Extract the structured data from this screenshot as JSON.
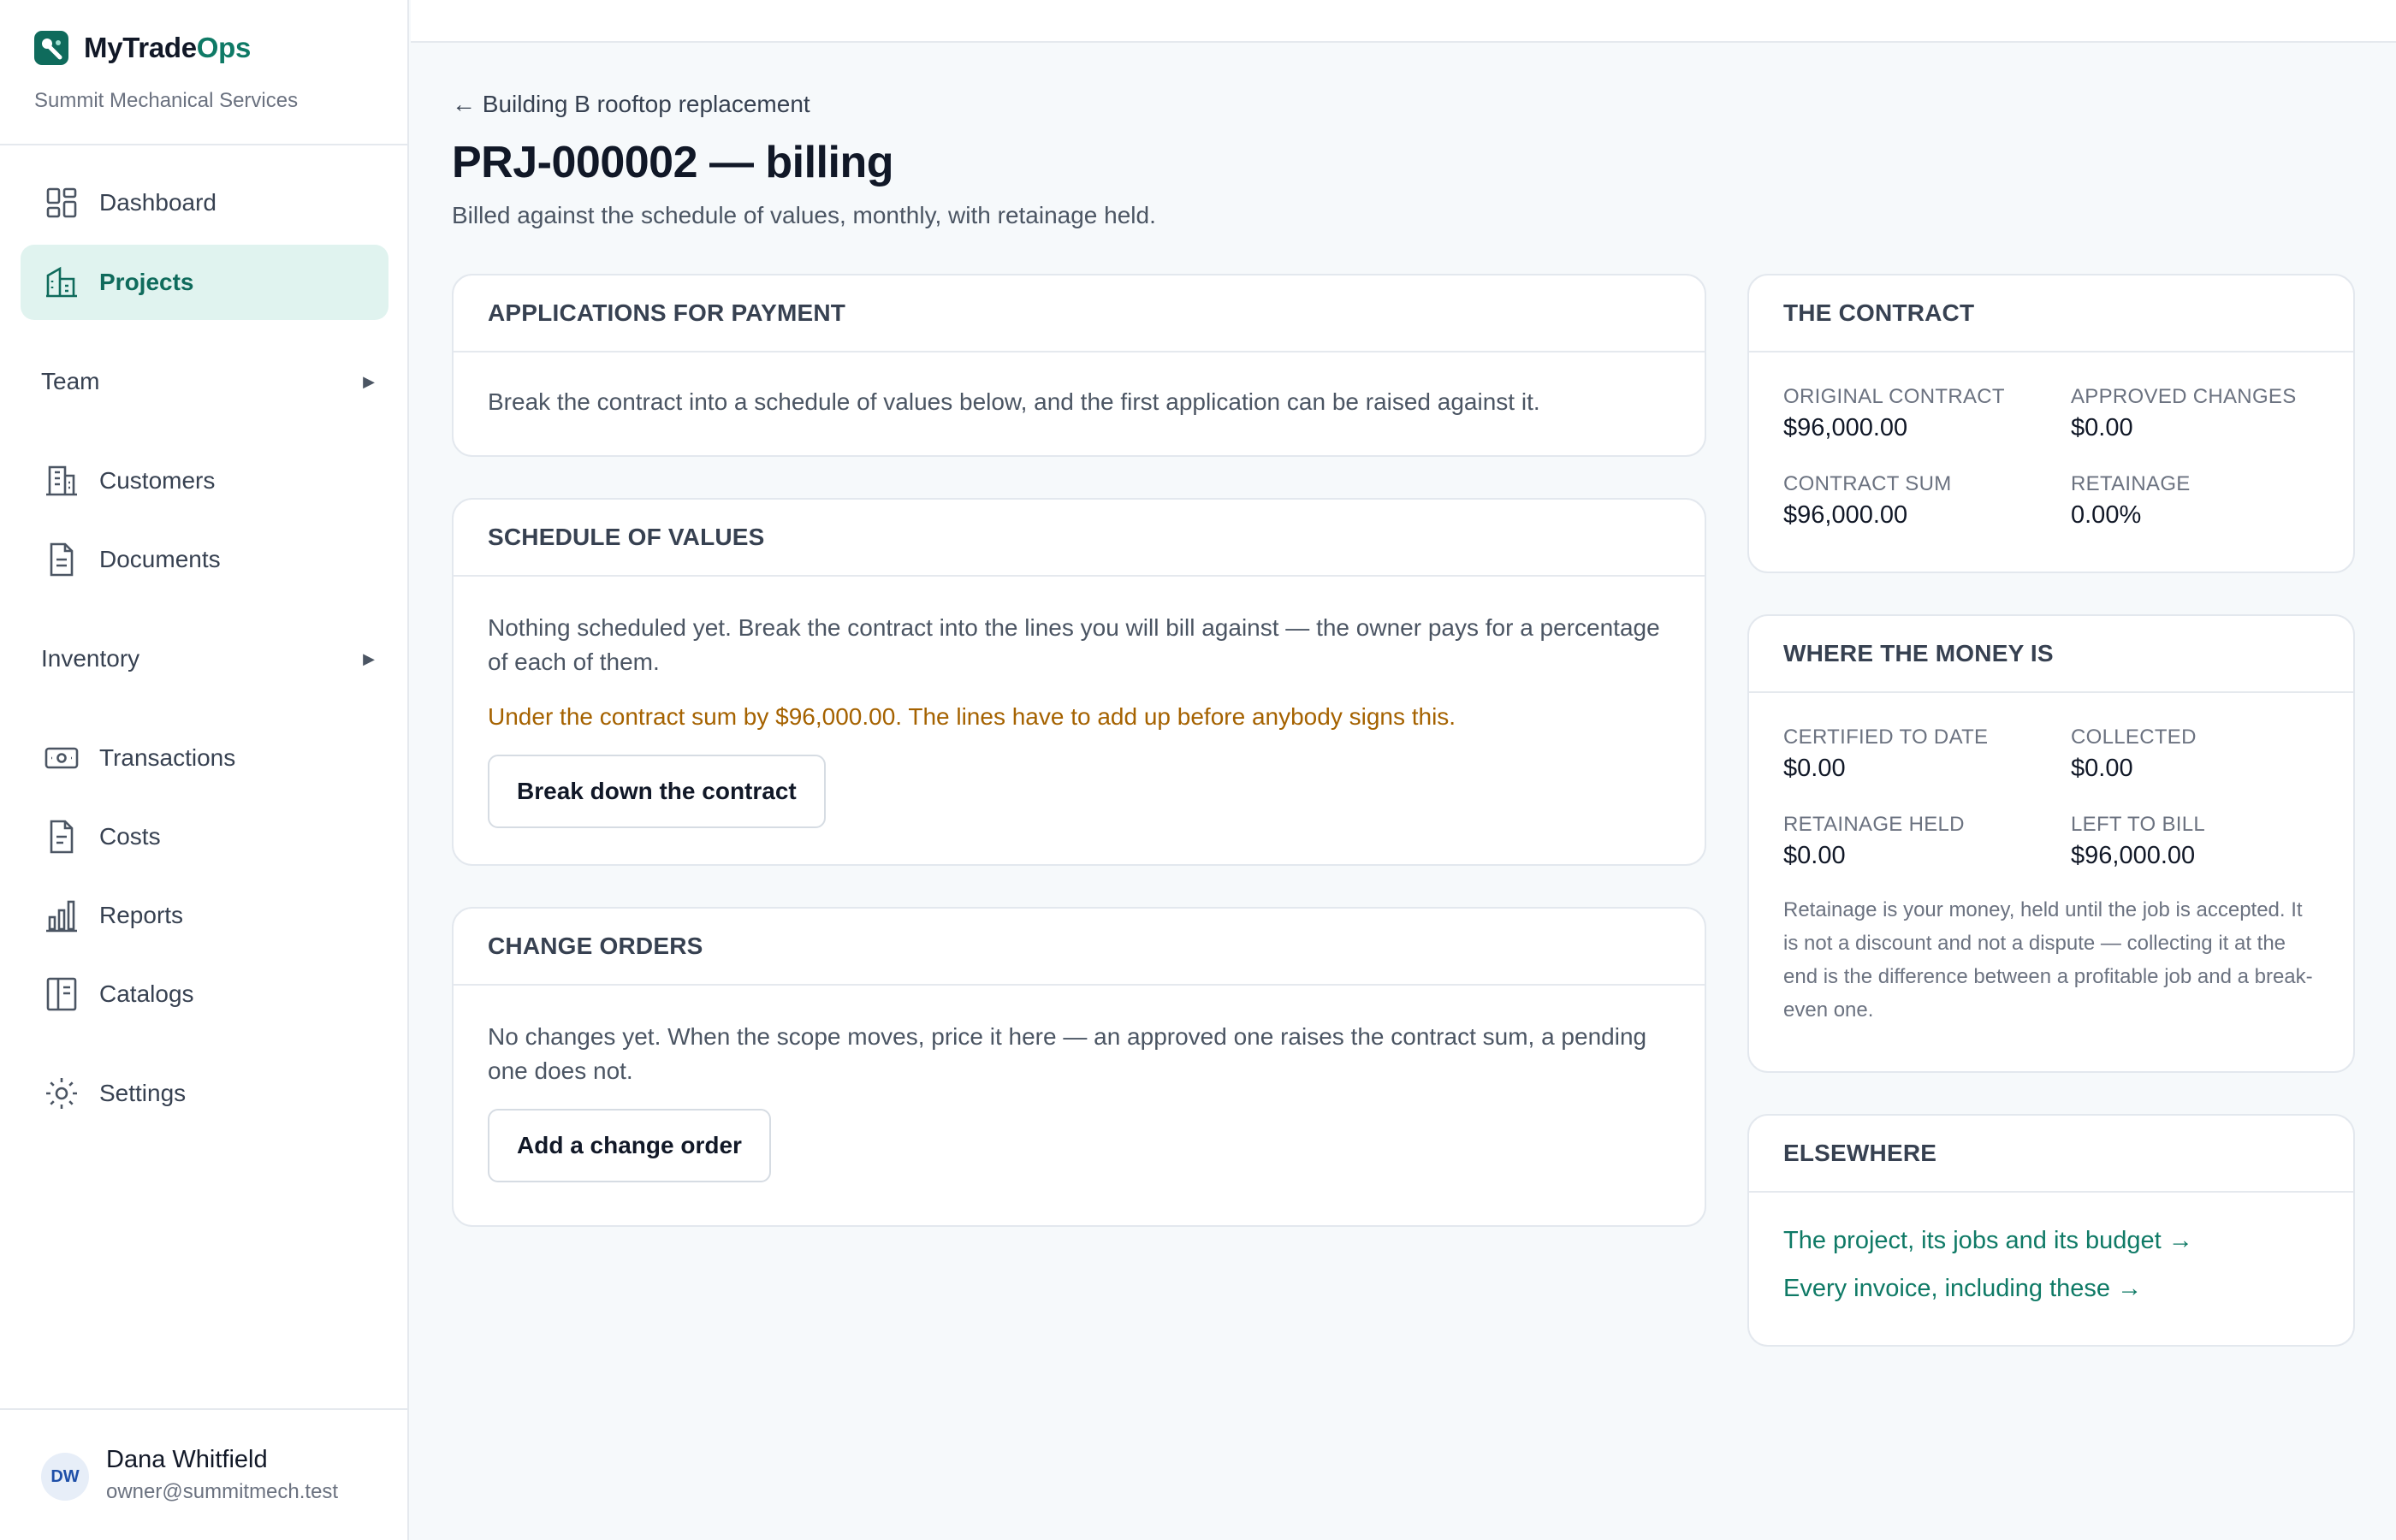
{
  "brand": {
    "name_main": "MyTrade",
    "name_accent": "Ops",
    "company": "Summit Mechanical Services"
  },
  "sidebar": {
    "items": [
      {
        "label": "Dashboard",
        "icon": "grid-icon"
      },
      {
        "label": "Projects",
        "icon": "building-icon",
        "active": true
      },
      {
        "label": "Team",
        "group": true
      },
      {
        "label": "Customers",
        "icon": "office-building-icon"
      },
      {
        "label": "Documents",
        "icon": "document-icon"
      },
      {
        "label": "Inventory",
        "group": true
      },
      {
        "label": "Transactions",
        "icon": "banknote-icon"
      },
      {
        "label": "Costs",
        "icon": "receipt-icon"
      },
      {
        "label": "Reports",
        "icon": "bar-chart-icon"
      },
      {
        "label": "Catalogs",
        "icon": "book-icon"
      },
      {
        "label": "Settings",
        "icon": "gear-icon"
      }
    ],
    "caret": "▶"
  },
  "user": {
    "initials": "DW",
    "name": "Dana Whitfield",
    "email": "owner@summitmech.test"
  },
  "header": {
    "back": "← Building B rooftop replacement",
    "title": "PRJ-000002 — billing",
    "subtitle": "Billed against the schedule of values, monthly, with retainage held."
  },
  "applications": {
    "title": "APPLICATIONS FOR PAYMENT",
    "text": "Break the contract into a schedule of values below, and the first application can be raised against it."
  },
  "sov": {
    "title": "SCHEDULE OF VALUES",
    "text": "Nothing scheduled yet. Break the contract into the lines you will bill against — the owner pays for a percentage of each of them.",
    "warning": "Under the contract sum by $96,000.00. The lines have to add up before anybody signs this.",
    "button": "Break down the contract"
  },
  "change_orders": {
    "title": "CHANGE ORDERS",
    "text": "No changes yet. When the scope moves, price it here — an approved one raises the contract sum, a pending one does not.",
    "button": "Add a change order"
  },
  "contract": {
    "title": "THE CONTRACT",
    "original_label": "ORIGINAL CONTRACT",
    "original_value": "$96,000.00",
    "changes_label": "APPROVED CHANGES",
    "changes_value": "$0.00",
    "sum_label": "CONTRACT SUM",
    "sum_value": "$96,000.00",
    "retainage_label": "RETAINAGE",
    "retainage_value": "0.00%"
  },
  "money": {
    "title": "WHERE THE MONEY IS",
    "certified_label": "CERTIFIED TO DATE",
    "certified_value": "$0.00",
    "collected_label": "COLLECTED",
    "collected_value": "$0.00",
    "held_label": "RETAINAGE HELD",
    "held_value": "$0.00",
    "left_label": "LEFT TO BILL",
    "left_value": "$96,000.00",
    "note": "Retainage is your money, held until the job is accepted. It is not a discount and not a dispute — collecting it at the end is the difference between a profitable job and a break-even one."
  },
  "elsewhere": {
    "title": "ELSEWHERE",
    "link1": "The project, its jobs and its budget →",
    "link2": "Every invoice, including these →"
  },
  "colors": {
    "accent": "#0f7a66",
    "active_bg": "#e0f3ef",
    "warning": "#a56200",
    "page_bg": "#f6f9fb"
  }
}
